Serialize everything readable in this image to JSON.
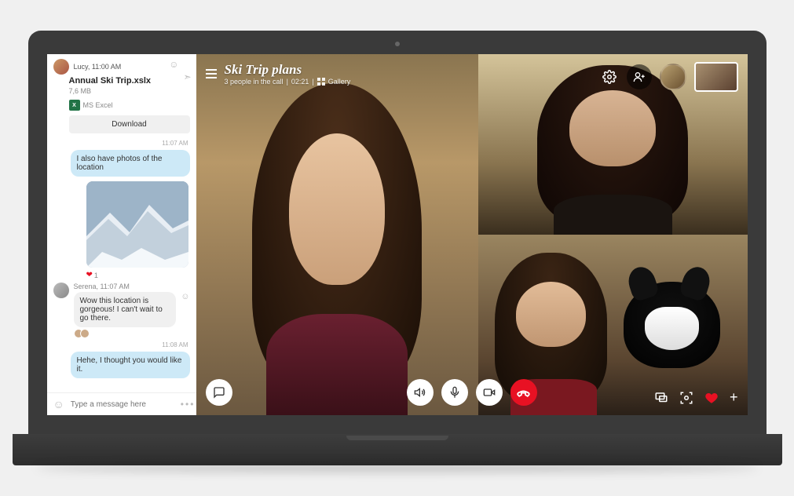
{
  "chat": {
    "sender1": {
      "name": "Lucy",
      "time": "11:00 AM"
    },
    "file": {
      "name": "Annual Ski Trip.xslx",
      "size": "7,6 MB",
      "type": "MS Excel",
      "download": "Download"
    },
    "ts1": "11:07 AM",
    "msg1": "I also have photos of the location",
    "heart_count": "1",
    "sender2": {
      "name": "Serena",
      "time": "11:07 AM"
    },
    "msg2": "Wow this location is gorgeous! I can't wait to go there.",
    "ts2": "11:08 AM",
    "msg3": "Hehe, I thought you would like it.",
    "composer_placeholder": "Type a message here"
  },
  "call": {
    "title": "Ski Trip plans",
    "sub_people": "3 people in the call",
    "sub_time": "02:21",
    "sub_gallery": "Gallery"
  }
}
